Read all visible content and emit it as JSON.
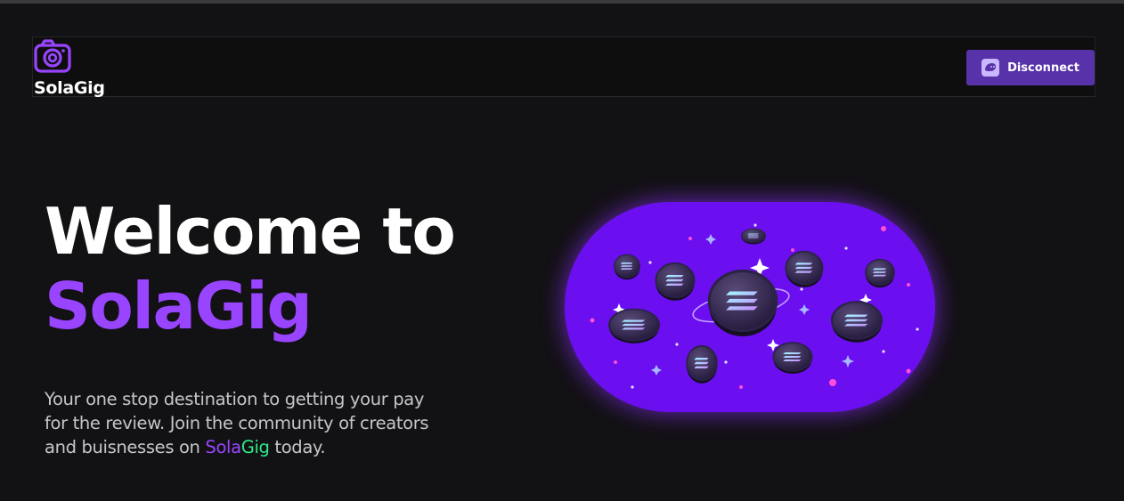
{
  "header": {
    "brand": "SolaGig",
    "disconnect_label": "Disconnect"
  },
  "hero": {
    "title_line1": "Welcome to",
    "title_line2": "SolaGig",
    "tagline_before": "Your one stop destination to getting your pay for the review. Join the community of creators and buisnesses on ",
    "tagline_sola": "Sola",
    "tagline_gig": "Gig",
    "tagline_after": " today."
  },
  "colors": {
    "background": "#121113",
    "accent_purple": "#9945ff",
    "accent_green": "#2ee889",
    "button": "#5832a8",
    "illustration": "#6b0ff0"
  },
  "icons": [
    "camera-icon",
    "wallet-icon",
    "solana-coins-illustration"
  ]
}
